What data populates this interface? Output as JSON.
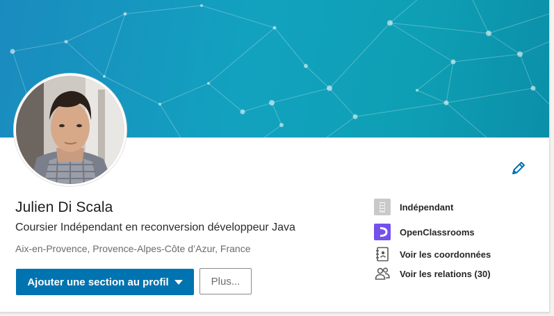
{
  "profile": {
    "name": "Julien Di Scala",
    "headline": "Coursier Indépendant en reconversion développeur Java",
    "location": "Aix-en-Provence, Provence-Alpes-Côte d’Azur, France"
  },
  "actions": {
    "add_section_label": "Ajouter une section au profil",
    "more_label": "Plus..."
  },
  "side": {
    "company": "Indépendant",
    "school": "OpenClassrooms",
    "contact": "Voir les coordonnées",
    "connections": "Voir les relations (30)"
  },
  "colors": {
    "primary_button": "#0073b1",
    "banner": "#12a2bf",
    "school_logo": "#7451eb",
    "edit_icon": "#0073b1"
  },
  "icons": {
    "edit": "pencil-icon",
    "company": "building-icon",
    "school": "openclassrooms-logo-icon",
    "contact": "address-book-icon",
    "connections": "people-icon"
  }
}
